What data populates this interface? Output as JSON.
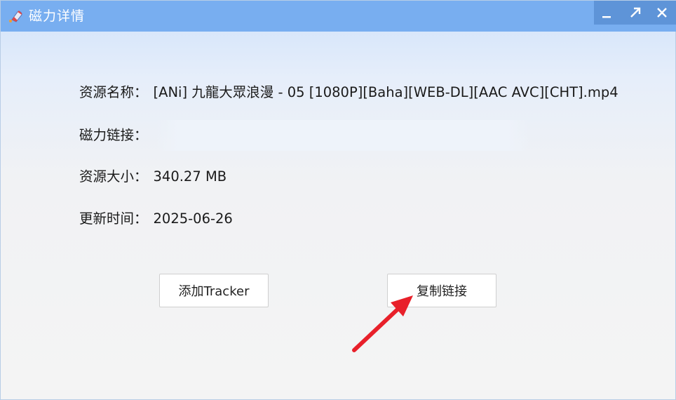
{
  "window": {
    "title": "磁力详情",
    "icon": "magnet-icon",
    "controls": [
      "minimize-icon",
      "maximize-icon",
      "close-icon"
    ]
  },
  "details": {
    "name": {
      "label": "资源名称：",
      "value": "[ANi] 九龍大眾浪漫 - 05 [1080P][Baha][WEB-DL][AAC AVC][CHT].mp4"
    },
    "magnet": {
      "label": "磁力链接：",
      "value": ""
    },
    "size": {
      "label": "资源大小：",
      "value": "340.27 MB"
    },
    "updated": {
      "label": "更新时间：",
      "value": "2025-06-26"
    }
  },
  "buttons": {
    "add_tracker": "添加Tracker",
    "copy_link": "复制链接"
  },
  "colors": {
    "titlebar": "#78aef0",
    "controls_bg": "#5e94d8",
    "annotation_arrow": "#e8202a"
  }
}
